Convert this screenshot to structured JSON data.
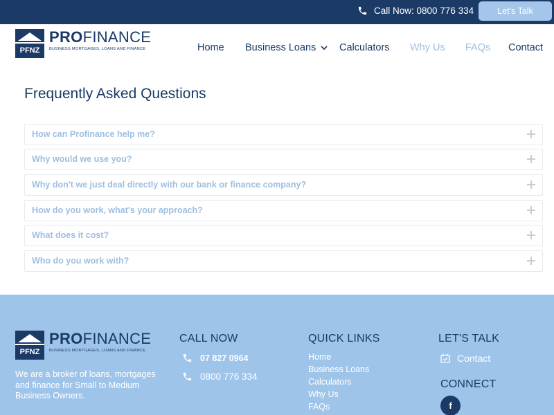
{
  "topbar": {
    "call_label": "Call Now: 0800 776 334",
    "talk_button": "Let's Talk"
  },
  "brand": {
    "mark_text": "PFNZ",
    "name_bold": "PRO",
    "name_rest": "FINANCE",
    "tagline": "BUSINESS MORTGAGES, LOANS AND FINANCE"
  },
  "nav": {
    "items": [
      {
        "label": "Home"
      },
      {
        "label": "Business Loans"
      },
      {
        "label": "Calculators"
      },
      {
        "label": "Why Us"
      },
      {
        "label": "FAQs"
      },
      {
        "label": "Contact"
      }
    ]
  },
  "faq": {
    "title": "Frequently Asked Questions",
    "questions": [
      "How can Profinance help me?",
      "Why would we use you?",
      "Why don't we just deal directly with our bank or finance company?",
      "How do you work, what's your approach?",
      "What does it cost?",
      "Who do you work with?"
    ]
  },
  "footer": {
    "description": "We are a broker of loans, mortgages and finance for Small to Medium Business Owners.",
    "call_heading": "CALL NOW",
    "phones": [
      "07 827 0964",
      "0800 776 334"
    ],
    "links_heading": "QUICK LINKS",
    "links": [
      "Home",
      "Business Loans",
      "Calculators",
      "Why Us",
      "FAQs"
    ],
    "talk_heading": "LET'S TALK",
    "contact_label": "Contact",
    "connect_heading": "CONNECT",
    "facebook_glyph": "f"
  },
  "colors": {
    "navy": "#1b3a66",
    "light_blue": "#9ebfe0",
    "footer_bg": "#9ec4ea",
    "button_bg": "#a4c6ea"
  }
}
